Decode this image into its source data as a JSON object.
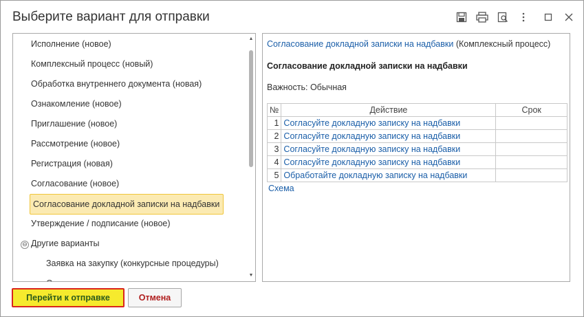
{
  "window": {
    "title": "Выберите вариант для отправки",
    "toolbar_icons": [
      "save-icon",
      "print-icon",
      "preview-icon",
      "more-icon",
      "maximize-icon",
      "close-icon"
    ]
  },
  "variants": {
    "items": [
      "Исполнение (новое)",
      "Комплексный процесс (новый)",
      "Обработка внутреннего документа (новая)",
      "Ознакомление (новое)",
      "Приглашение (новое)",
      "Рассмотрение (новое)",
      "Регистрация (новая)",
      "Согласование (новое)",
      "Согласование докладной записки на надбавки",
      "Утверждение / подписание (новое)"
    ],
    "selected_index": 8,
    "group_label": "Другие варианты",
    "group_toggle": "⊖",
    "group_items": [
      "Заявка на закупку (конкурсные процедуры)"
    ]
  },
  "details": {
    "process_link": "Согласование докладной записки на надбавки",
    "process_type": "(Комплексный процесс)",
    "heading": "Согласование докладной записки на надбавки",
    "importance": "Важность: Обычная",
    "table": {
      "columns": [
        "№",
        "Действие",
        "Срок"
      ],
      "rows": [
        {
          "num": "1",
          "action": "Согласуйте докладную записку на надбавки",
          "deadline": ""
        },
        {
          "num": "2",
          "action": "Согласуйте докладную записку на надбавки",
          "deadline": ""
        },
        {
          "num": "3",
          "action": "Согласуйте докладную записку на надбавки",
          "deadline": ""
        },
        {
          "num": "4",
          "action": "Согласуйте докладную записку на надбавки",
          "deadline": ""
        },
        {
          "num": "5",
          "action": "Обработайте докладную записку на надбавки",
          "deadline": ""
        }
      ]
    },
    "scheme_link": "Схема"
  },
  "buttons": {
    "submit": "Перейти к отправке",
    "cancel": "Отмена"
  },
  "colors": {
    "link": "#1a5ea8",
    "selected_bg": "#fbeab2",
    "selected_border": "#f0c53a",
    "primary_bg": "#f6ea2d",
    "primary_border": "#d9241c",
    "cancel_text": "#b01e1e"
  }
}
